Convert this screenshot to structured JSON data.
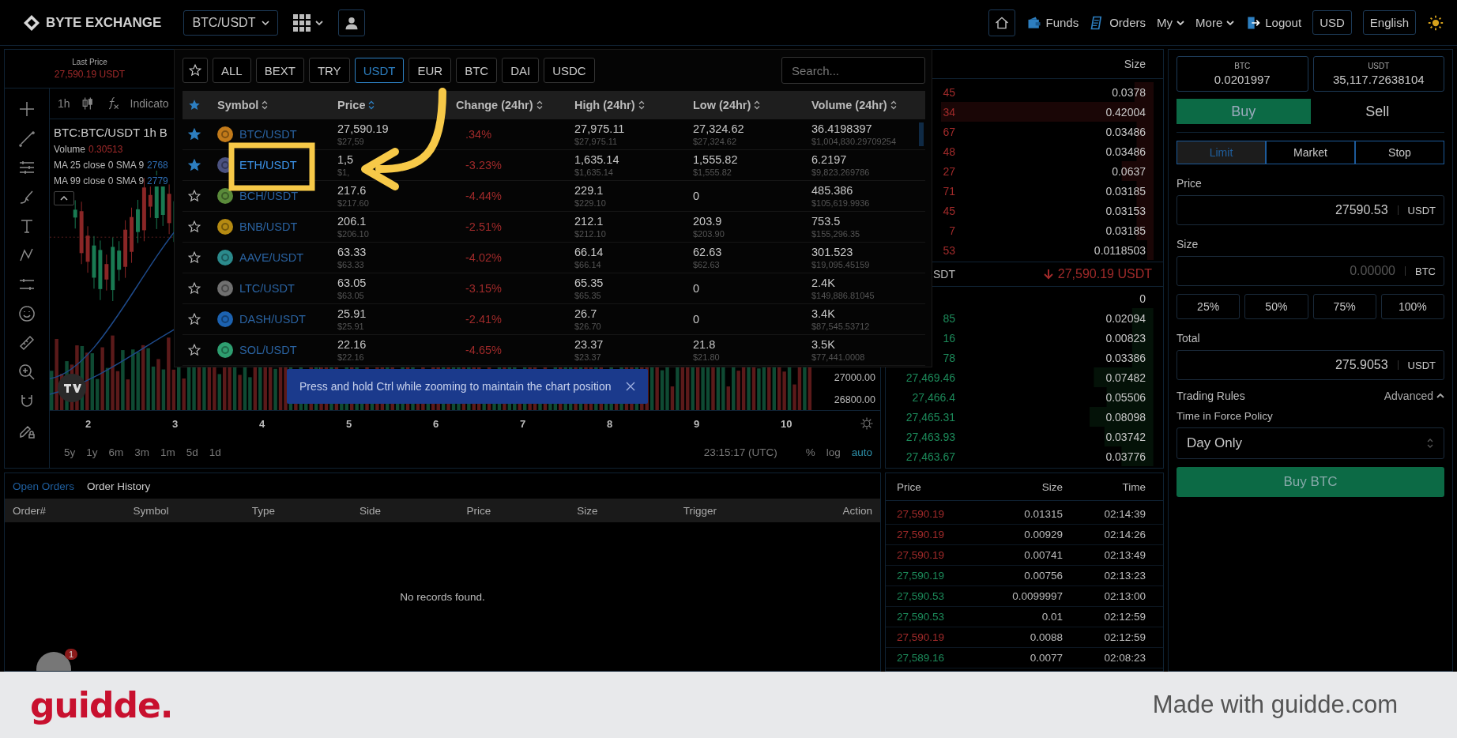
{
  "header": {
    "logo": "BYTE EXCHANGE",
    "pair": "BTC/USDT",
    "nav": [
      {
        "label": "Funds",
        "kind": "wallet"
      },
      {
        "label": "Orders",
        "kind": "orders"
      },
      {
        "label": "My",
        "kind": "menu"
      },
      {
        "label": "More",
        "kind": "menu"
      },
      {
        "label": "Logout",
        "kind": "logout"
      }
    ],
    "currency": "USD",
    "language": "English"
  },
  "chart": {
    "last_price_label": "Last Price",
    "last_price": "27,590.19 USDT",
    "interval": "1h",
    "indicators": "Indicato",
    "legend_title": [
      "BTC:BTC/USDT",
      "1h",
      "B"
    ],
    "volume_label": "Volume",
    "volume_value": "0.30513",
    "ma": [
      {
        "label": "MA 25 close 0 SMA 9",
        "value": "2768"
      },
      {
        "label": "MA 99 close 0 SMA 9",
        "value": "2779"
      }
    ],
    "y_labels": [
      "27000.00",
      "26800.00"
    ],
    "x_labels": [
      "2",
      "3",
      "4",
      "5",
      "6",
      "7",
      "8",
      "9",
      "10"
    ],
    "ranges": [
      "5y",
      "1y",
      "6m",
      "3m",
      "1m",
      "5d",
      "1d"
    ],
    "clock": "23:15:17 (UTC)",
    "scale_options": [
      {
        "label": "%",
        "selected": false
      },
      {
        "label": "log",
        "selected": false
      },
      {
        "label": "auto",
        "selected": true
      }
    ],
    "tooltip": "Press and hold Ctrl while zooming to maintain the chart position"
  },
  "market_dropdown": {
    "tabs": [
      {
        "label": "ALL",
        "selected": false
      },
      {
        "label": "BEXT",
        "selected": false
      },
      {
        "label": "TRY",
        "selected": false
      },
      {
        "label": "USDT",
        "selected": true
      },
      {
        "label": "EUR",
        "selected": false
      },
      {
        "label": "BTC",
        "selected": false
      },
      {
        "label": "DAI",
        "selected": false
      },
      {
        "label": "USDC",
        "selected": false
      }
    ],
    "search_placeholder": "Search...",
    "columns": [
      "Symbol",
      "Price",
      "Change (24hr)",
      "High (24hr)",
      "Low (24hr)",
      "Volume (24hr)"
    ],
    "rows": [
      {
        "favorite": true,
        "selected": false,
        "symbol": "BTC/USDT",
        "color": "#c27a1a",
        "price": "27,590.19",
        "price_usd": "$27,59",
        "change": ".34%",
        "high": "27,975.11",
        "high_usd": "$27,975.11",
        "low": "27,324.62",
        "low_usd": "$27,324.62",
        "volume": "36.4198397",
        "volume_usd": "$1,004,830.29709254"
      },
      {
        "favorite": true,
        "selected": true,
        "symbol": "ETH/USDT",
        "color": "#4b5280",
        "price": "1,5",
        "price_usd": "$1,",
        "change": "-3.23%",
        "high": "1,635.14",
        "high_usd": "$1,635.14",
        "low": "1,555.82",
        "low_usd": "$1,555.82",
        "volume": "6.2197",
        "volume_usd": "$9,823.269786"
      },
      {
        "favorite": false,
        "selected": false,
        "symbol": "BCH/USDT",
        "color": "#5a8a3a",
        "price": "217.6",
        "price_usd": "$217.60",
        "change": "-4.44%",
        "high": "229.1",
        "high_usd": "$229.10",
        "low": "0",
        "low_usd": "",
        "volume": "485.386",
        "volume_usd": "$105,619.9936"
      },
      {
        "favorite": false,
        "selected": false,
        "symbol": "BNB/USDT",
        "color": "#b58a12",
        "price": "206.1",
        "price_usd": "$206.10",
        "change": "-2.51%",
        "high": "212.1",
        "high_usd": "$212.10",
        "low": "203.9",
        "low_usd": "$203.90",
        "volume": "753.5",
        "volume_usd": "$155,296.35"
      },
      {
        "favorite": false,
        "selected": false,
        "symbol": "AAVE/USDT",
        "color": "#2b8a8c",
        "price": "63.33",
        "price_usd": "$63.33",
        "change": "-4.02%",
        "high": "66.14",
        "high_usd": "$66.14",
        "low": "62.63",
        "low_usd": "$62.63",
        "volume": "301.523",
        "volume_usd": "$19,095.45159"
      },
      {
        "favorite": false,
        "selected": false,
        "symbol": "LTC/USDT",
        "color": "#707070",
        "price": "63.05",
        "price_usd": "$63.05",
        "change": "-3.15%",
        "high": "65.35",
        "high_usd": "$65.35",
        "low": "0",
        "low_usd": "",
        "volume": "2.4K",
        "volume_usd": "$149,886.81045"
      },
      {
        "favorite": false,
        "selected": false,
        "symbol": "DASH/USDT",
        "color": "#1c62b0",
        "price": "25.91",
        "price_usd": "$25.91",
        "change": "-2.41%",
        "high": "26.7",
        "high_usd": "$26.70",
        "low": "0",
        "low_usd": "",
        "volume": "3.4K",
        "volume_usd": "$87,545.53712"
      },
      {
        "favorite": false,
        "selected": false,
        "symbol": "SOL/USDT",
        "color": "#2e9e70",
        "price": "22.16",
        "price_usd": "$22.16",
        "change": "-4.65%",
        "high": "23.37",
        "high_usd": "$23.37",
        "low": "21.8",
        "low_usd": "$21.80",
        "volume": "3.5K",
        "volume_usd": "$77,441.0008"
      }
    ]
  },
  "orders": {
    "tabs": [
      {
        "label": "Open Orders",
        "selected": true
      },
      {
        "label": "Order History",
        "selected": false
      }
    ],
    "columns": [
      "Order#",
      "Symbol",
      "Type",
      "Side",
      "Price",
      "Size",
      "Trigger",
      "Action"
    ],
    "empty": "No records found."
  },
  "order_book": {
    "size_header": "Size",
    "asks": [
      {
        "price": "45",
        "size": "0.0378"
      },
      {
        "price": "34",
        "size": "0.42004"
      },
      {
        "price": "67",
        "size": "0.03486"
      },
      {
        "price": "48",
        "size": "0.03486"
      },
      {
        "price": "27",
        "size": "0.0637"
      },
      {
        "price": "71",
        "size": "0.03185"
      },
      {
        "price": "45",
        "size": "0.03153"
      },
      {
        "price": "7",
        "size": "0.03185"
      },
      {
        "price": "53",
        "size": "0.0118503"
      }
    ],
    "mid_label": "SDT",
    "last_price": "27,590.19 USDT",
    "bids": [
      {
        "size": "0"
      },
      {
        "price": "85",
        "size": "0.02094"
      },
      {
        "price": "16",
        "size": "0.00823"
      },
      {
        "price": "78",
        "size": "0.03386"
      },
      {
        "price": "27,469.46",
        "size": "0.07482"
      },
      {
        "price": "27,466.4",
        "size": "0.05506"
      },
      {
        "price": "27,465.31",
        "size": "0.08098"
      },
      {
        "price": "27,463.93",
        "size": "0.03742"
      },
      {
        "price": "27,463.67",
        "size": "0.03776"
      }
    ]
  },
  "trades": {
    "columns": [
      "Price",
      "Size",
      "Time"
    ],
    "rows": [
      {
        "price": "27,590.19",
        "size": "0.01315",
        "time": "02:14:39",
        "kind": "sell"
      },
      {
        "price": "27,590.19",
        "size": "0.00929",
        "time": "02:14:26",
        "kind": "sell"
      },
      {
        "price": "27,590.19",
        "size": "0.00741",
        "time": "02:13:49",
        "kind": "sell"
      },
      {
        "price": "27,590.19",
        "size": "0.00756",
        "time": "02:13:23",
        "kind": "buy"
      },
      {
        "price": "27,590.53",
        "size": "0.0099997",
        "time": "02:13:00",
        "kind": "buy"
      },
      {
        "price": "27,590.53",
        "size": "0.01",
        "time": "02:12:59",
        "kind": "buy"
      },
      {
        "price": "27,590.19",
        "size": "0.0088",
        "time": "02:12:59",
        "kind": "sell"
      },
      {
        "price": "27,589.16",
        "size": "0.0077",
        "time": "02:08:23",
        "kind": "buy"
      }
    ]
  },
  "trade_panel": {
    "balances": [
      {
        "currency": "BTC",
        "amount": "0.0201997"
      },
      {
        "currency": "USDT",
        "amount": "35,117.72638104"
      }
    ],
    "sides": [
      {
        "label": "Buy",
        "selected": true
      },
      {
        "label": "Sell",
        "selected": false
      }
    ],
    "order_types": [
      {
        "label": "Limit",
        "selected": true
      },
      {
        "label": "Market",
        "selected": false
      },
      {
        "label": "Stop",
        "selected": false
      }
    ],
    "price": {
      "label": "Price",
      "value": "27590.53",
      "unit": "USDT"
    },
    "size": {
      "label": "Size",
      "placeholder": "0.00000",
      "unit": "BTC"
    },
    "percents": [
      "25%",
      "50%",
      "75%",
      "100%"
    ],
    "total": {
      "label": "Total",
      "value": "275.9053",
      "unit": "USDT"
    },
    "rules_label": "Trading Rules",
    "advanced": {
      "label": "Advanced",
      "expanded": true
    },
    "tif_label": "Time in Force Policy",
    "tif_value": "Day Only",
    "submit": "Buy BTC"
  },
  "notification_badge": "1",
  "footer": {
    "logo": "guidde.",
    "tagline": "Made with guidde.com"
  }
}
